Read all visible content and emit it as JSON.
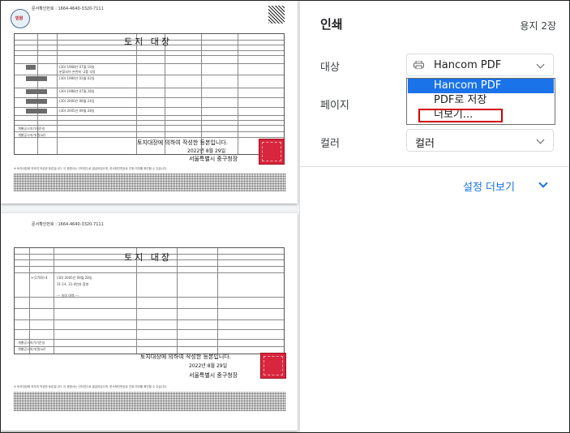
{
  "print_panel": {
    "title": "인쇄",
    "page_count": "용지 2장",
    "destination": {
      "label": "대상",
      "value": "Hancom PDF",
      "options": [
        "Hancom PDF",
        "PDF로 저장",
        "더보기..."
      ]
    },
    "pages_label": "페이지",
    "color": {
      "label": "컬러",
      "value": "컬러"
    },
    "more_settings": "설정 더보기"
  },
  "preview": {
    "page1": {
      "doc_number": "문서확인번호 : 1664-4640-3320-7111",
      "title": "토지 대장",
      "certify": "토지대장에 의하여 작성한 등본입니다.",
      "date": "2022년 8월 29일",
      "issuer": "서울특별시 중구청장",
      "seal_text": "민원"
    },
    "page2": {
      "doc_number": "문서확인번호 : 1664-4640-3320-7111",
      "title": "토지 대장",
      "certify": "토지대장에 의하여 작성한 등본입니다.",
      "date": "2022년 8월 29일",
      "issuer": "서울특별시 중구청장"
    }
  },
  "colors": {
    "accent": "#1a73e8",
    "highlight_box": "#d40000",
    "stamp": "#d7263d"
  }
}
